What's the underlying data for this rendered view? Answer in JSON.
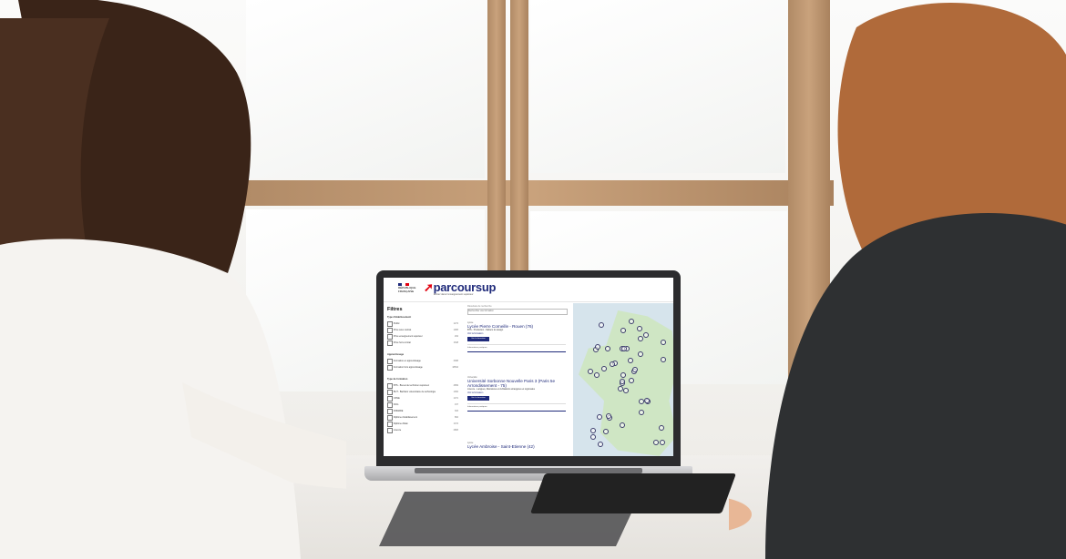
{
  "scene": {
    "description_free": true
  },
  "screen": {
    "header": {
      "republic_label": "RÉPUBLIQUE FRANÇAISE",
      "brand": "parcoursup",
      "brand_tagline": "Entrez dans l'enseignement supérieur"
    },
    "filters": {
      "title": "Filtres",
      "groups": [
        {
          "label": "Type d'établissement",
          "items": [
            {
              "label": "Public",
              "count": "1274"
            },
            {
              "label": "Privé sous contrat",
              "count": "1083"
            },
            {
              "label": "Privé enseignement supérieur",
              "count": "294"
            },
            {
              "label": "Privé hors contrat",
              "count": "1648"
            }
          ]
        },
        {
          "label": "Apprentissage",
          "items": [
            {
              "label": "Formation en apprentissage",
              "count": "3068"
            },
            {
              "label": "Formation hors apprentissage",
              "count": "18694"
            }
          ]
        },
        {
          "label": "Type de formation",
          "items": [
            {
              "label": "BTS - Brevet de technicien supérieur",
              "count": "4869"
            },
            {
              "label": "BUT - Bachelor universitaire de technologie",
              "count": "1062"
            },
            {
              "label": "CPGE",
              "count": "1071"
            },
            {
              "label": "DCG",
              "count": "197"
            },
            {
              "label": "DNMADE",
              "count": "303"
            },
            {
              "label": "Diplôme d'établissement",
              "count": "862"
            },
            {
              "label": "Diplôme d'Etat",
              "count": "1372"
            },
            {
              "label": "Licence",
              "count": "2883"
            }
          ]
        }
      ]
    },
    "results": {
      "breadcrumb": "Résultats de recherche",
      "search_placeholder": "Rechercher une formation",
      "cards": [
        {
          "kind": "Lycée",
          "title": "Lycée Pierre Corneille - Rouen (76)",
          "desc": "BTS - Production - Métiers du design",
          "link": "Voir la formation",
          "button": "Voir la formation",
          "more": "Informations pratiques"
        },
        {
          "kind": "Université",
          "title": "Université Sorbonne Nouvelle Paris 3 (Paris 5e Arrondissement - 75)",
          "desc": "Licence - Langues, littératures et civilisations étrangères et régionales",
          "link": "Voir la formation",
          "button": "Voir la formation",
          "more": "Informations pratiques"
        },
        {
          "kind": "Lycée",
          "title": "Lycée Ambroise - Saint-Etienne (42)",
          "desc": "",
          "link": "",
          "button": "",
          "more": ""
        }
      ]
    },
    "map": {
      "kind": "map-of-france",
      "markers": 44
    }
  }
}
